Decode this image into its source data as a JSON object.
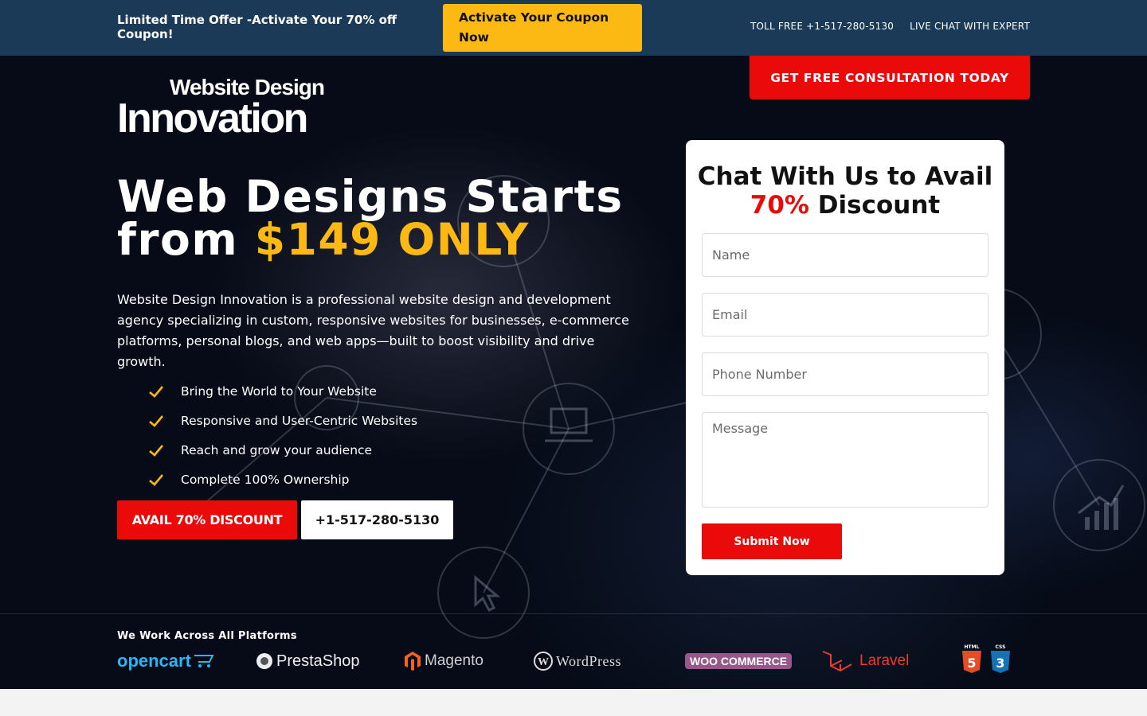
{
  "topbar": {
    "offer_text": "Limited Time Offer -Activate Your 70% off Coupon!",
    "coupon_button": "Activate Your Coupon Now",
    "toll_free": "TOLL FREE +1-517-280-5130",
    "live_chat": "LIVE CHAT WITH EXPERT"
  },
  "header": {
    "consult_button": "GET FREE CONSULTATION TODAY",
    "logo_line1": "Website Design",
    "logo_line2": "Innovation"
  },
  "hero": {
    "headline_part1": "Web Designs Starts",
    "headline_part2": "from ",
    "headline_price": "$149 ONLY",
    "description": "Website Design Innovation is a professional website design and development agency specializing in custom, responsive websites for businesses, e-commerce platforms, personal blogs, and web apps—built to boost visibility and drive growth.",
    "features": [
      "Bring the World to Your Website",
      "Responsive and User-Centric Websites",
      "Reach and grow your audience",
      "Complete 100% Ownership"
    ],
    "avail_button": "AVAIL 70% DISCOUNT",
    "phone_button": "+1-517-280-5130"
  },
  "form": {
    "title_part1": "Chat With Us to Avail",
    "title_highlight": "70%",
    "title_part2": " Discount",
    "name_placeholder": "Name",
    "email_placeholder": "Email",
    "phone_placeholder": "Phone Number",
    "message_placeholder": "Message",
    "submit_label": "Submit Now"
  },
  "platforms": {
    "title": "We Work Across All Platforms",
    "logos": [
      "opencart",
      "PrestaShop",
      "Magento",
      "WordPress",
      "WOO COMMERCE",
      "Laravel",
      "HTML",
      "CSS"
    ]
  },
  "colors": {
    "topbar_bg": "#1b3a57",
    "accent_yellow": "#fdb913",
    "accent_red": "#ea0a0a",
    "hero_bg": "#060b17"
  }
}
